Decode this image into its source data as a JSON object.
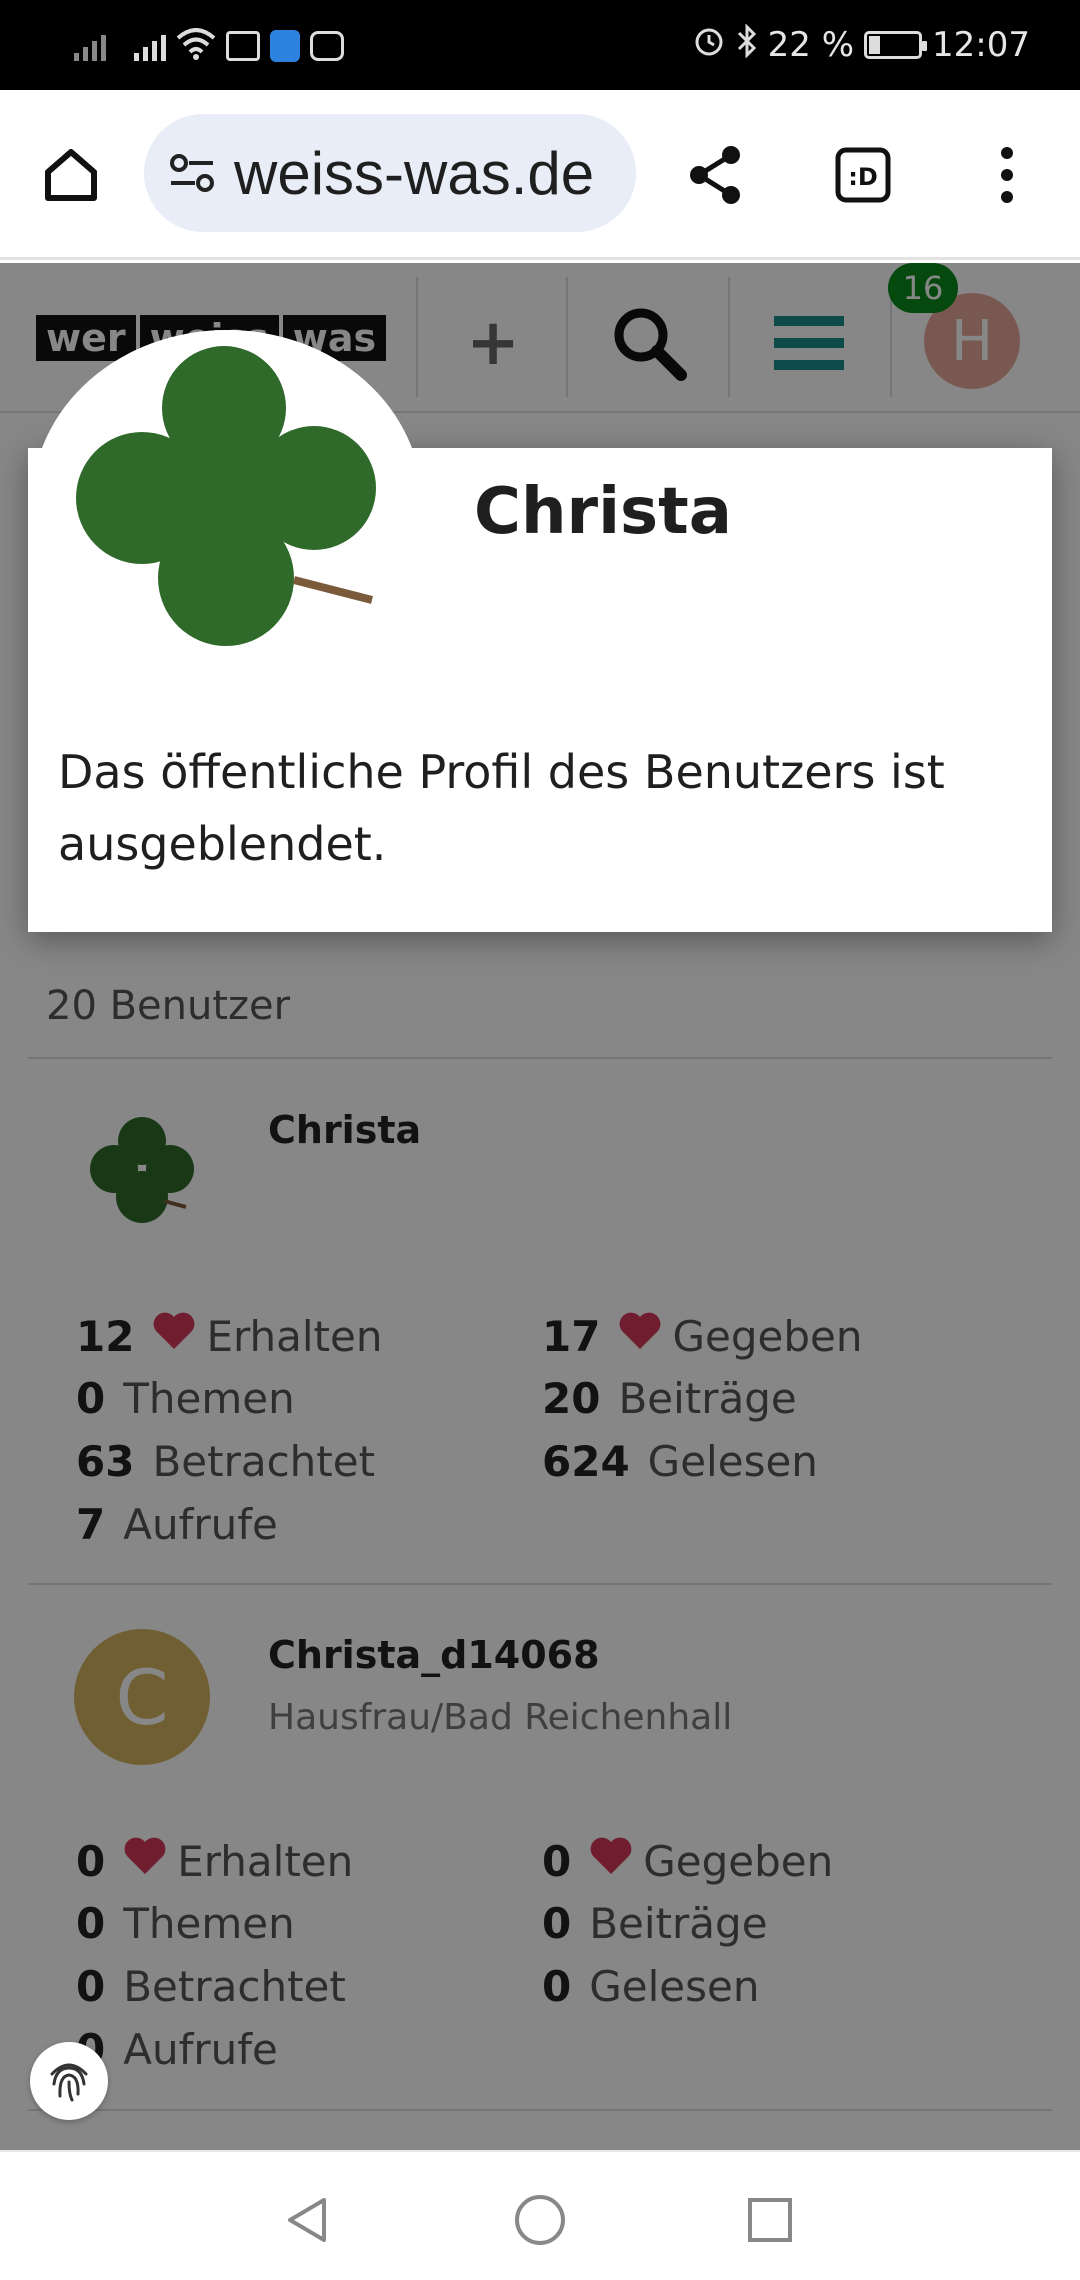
{
  "status_bar": {
    "battery": "22 %",
    "battery_level": 0.22,
    "time": "12:07",
    "icons": [
      "signal-icon",
      "wifi-icon",
      "mail-icon",
      "shield-icon",
      "app-icon",
      "alarm-icon",
      "bluetooth-icon",
      "battery-icon"
    ]
  },
  "browser": {
    "url": "weiss-was.de",
    "buttons": [
      "home-icon",
      "site-settings-icon",
      "share-icon",
      "tabs-icon",
      "more-icon"
    ],
    "tabs_label": ":D"
  },
  "site_header": {
    "logo_parts": [
      "wer",
      "weiss",
      "was"
    ],
    "add_label": "+",
    "notification_count": "16",
    "user_initial": "H"
  },
  "modal": {
    "name": "Christa",
    "message": "Das öffentliche Profil des Benutzers ist ausgeblendet."
  },
  "user_list": {
    "count_label": "20 Benutzer",
    "users": [
      {
        "name": "Christa",
        "subtitle": "",
        "avatar": "clover-avatar",
        "stats_left": [
          {
            "value": "12",
            "label": "Erhalten",
            "heart": true
          },
          {
            "value": "0",
            "label": "Themen"
          },
          {
            "value": "63",
            "label": "Betrachtet"
          },
          {
            "value": "7",
            "label": "Aufrufe"
          }
        ],
        "stats_right": [
          {
            "value": "17",
            "label": "Gegeben",
            "heart": true
          },
          {
            "value": "20",
            "label": "Beiträge"
          },
          {
            "value": "624",
            "label": "Gelesen"
          }
        ]
      },
      {
        "name": "Christa_d14068",
        "subtitle": "Hausfrau/Bad Reichenhall",
        "avatar_initial": "C",
        "stats_left": [
          {
            "value": "0",
            "label": "Erhalten",
            "heart": true
          },
          {
            "value": "0",
            "label": "Themen"
          },
          {
            "value": "0",
            "label": "Betrachtet"
          },
          {
            "value": "0",
            "label": "Aufrufe"
          }
        ],
        "stats_right": [
          {
            "value": "0",
            "label": "Gegeben",
            "heart": true
          },
          {
            "value": "0",
            "label": "Beiträge"
          },
          {
            "value": "0",
            "label": "Gelesen"
          }
        ]
      }
    ]
  },
  "colors": {
    "heart": "#d43a5a",
    "notification": "#0b8a1e",
    "user_avatar": "#e7a79b",
    "c_avatar": "#d4b35f",
    "menu_teal": "#1a8f8f"
  }
}
